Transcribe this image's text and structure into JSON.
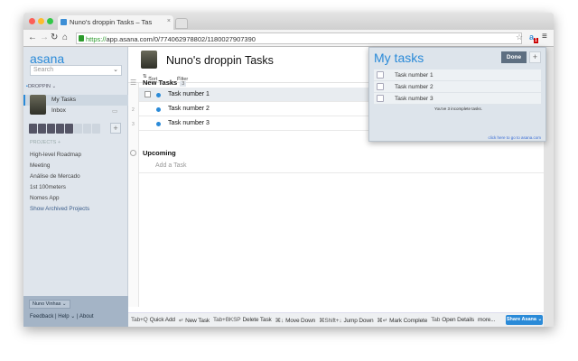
{
  "browser": {
    "tab_title": "Nuno's droppin Tasks – Tas",
    "url_scheme": "https://",
    "url_rest": "app.asana.com/0/774062978802/1180027907390",
    "extension_badge": "1"
  },
  "sidebar": {
    "logo": "asana",
    "search_placeholder": "Search",
    "workspace": "DROPPIN",
    "my_tasks": "My Tasks",
    "inbox": "Inbox",
    "projects_header": "PROJECTS",
    "projects": [
      "High-level Roadmap",
      "Meeting",
      "Análise de Mercado",
      "1st 100meters",
      "Nomes App",
      "Show Archived Projects"
    ],
    "user": "Nuno Vinhas",
    "links": [
      "Feedback",
      "Help",
      "About"
    ]
  },
  "main": {
    "title": "Nuno's droppin Tasks",
    "sort": "Sort",
    "filter": "Filter",
    "sections": [
      {
        "name": "New Tasks",
        "count": "3"
      },
      {
        "name": "Upcoming"
      }
    ],
    "tasks": [
      {
        "num": "",
        "name": "Task number 1"
      },
      {
        "num": "2",
        "name": "Task number 2"
      },
      {
        "num": "3",
        "name": "Task number 3"
      }
    ],
    "add_task": "Add a Task",
    "shortcuts": [
      {
        "key": "Tab+Q",
        "label": "Quick Add"
      },
      {
        "key": "↵",
        "label": "New Task"
      },
      {
        "key": "Tab+BKSP",
        "label": "Delete Task"
      },
      {
        "key": "⌘↓",
        "label": "Move Down"
      },
      {
        "key": "⌘Shift+↓",
        "label": "Jump Down"
      },
      {
        "key": "⌘↵",
        "label": "Mark Complete"
      },
      {
        "key": "Tab",
        "label": "Open Details"
      },
      {
        "key": "",
        "label": "more..."
      }
    ],
    "share": "Share Asana"
  },
  "popup": {
    "title": "My tasks",
    "done": "Done",
    "add": "+",
    "tasks": [
      "Task number 1",
      "Task number 2",
      "Task number 3"
    ],
    "info": "You've 3 incomplete tasks.",
    "link": "click here to go to asana.com"
  },
  "colors": {
    "accent": "#2a8ad8"
  }
}
